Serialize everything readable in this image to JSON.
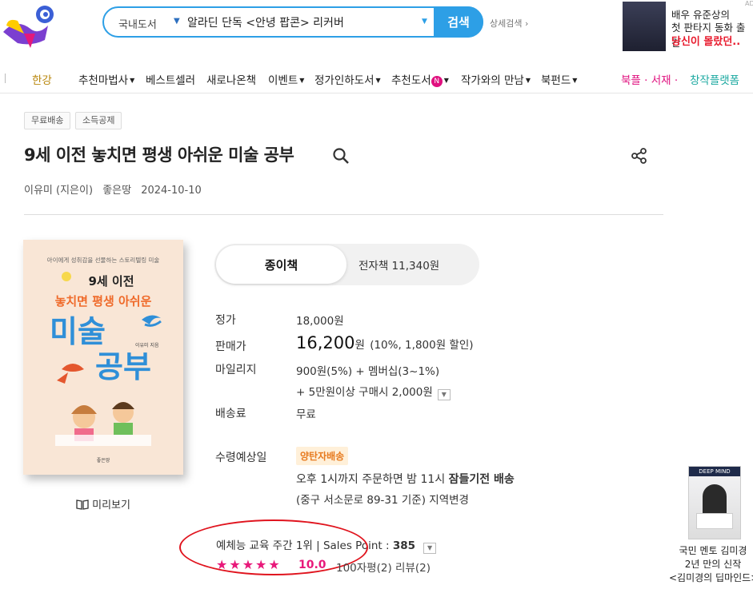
{
  "header": {
    "search": {
      "category": "국내도서",
      "query": "알라딘 단독 <안녕 팝콘> 리커버",
      "button": "검색"
    },
    "detail_search": "상세검색 ›",
    "ad": {
      "line1": "배우 유준상의",
      "line2": "첫 판타지 동화 출간",
      "line3": "당신이 몰랐던..",
      "mark": "AD"
    }
  },
  "nav": {
    "items": [
      {
        "label": "한강",
        "dropdown": false
      },
      {
        "label": "추천마법사",
        "dropdown": true
      },
      {
        "label": "베스트셀러",
        "dropdown": false
      },
      {
        "label": "새로나온책",
        "dropdown": false
      },
      {
        "label": "이벤트",
        "dropdown": true
      },
      {
        "label": "정가인하도서",
        "dropdown": true
      },
      {
        "label": "추천도서",
        "dropdown": true,
        "badge": "N"
      },
      {
        "label": "작가와의 만남",
        "dropdown": true
      },
      {
        "label": "북펀드",
        "dropdown": true
      }
    ],
    "right_links": {
      "bookple": "북플",
      "seojae": "서재",
      "changjak": "창작플랫폼"
    }
  },
  "product": {
    "tags": [
      "무료배송",
      "소득공제"
    ],
    "title": "9세 이전 놓치면 평생 아쉬운 미술 공부",
    "author": "이유미 (지은이)",
    "publisher": "좋은땅",
    "date": "2024-10-10",
    "cover": {
      "top_text": "아이에게 성취감을 선물하는 스토리텔링 미술",
      "title1": "9세 이전",
      "title2": "놓치면 평생 아쉬운",
      "title3": "미술",
      "title4": "공부",
      "author": "이유미 지음",
      "publisher": "좋은땅"
    },
    "preview": "미리보기",
    "format_tabs": {
      "paper": "종이책",
      "ebook": "전자책 11,340원"
    },
    "labels": {
      "list_price": "정가",
      "sale_price": "판매가",
      "mileage": "마일리지",
      "shipping": "배송료",
      "delivery_date": "수령예상일"
    },
    "list_price": "18,000원",
    "sale_price": "16,200",
    "sale_unit": "원",
    "discount": "(10%, 1,800원 할인)",
    "mileage1": "900원(5%) + 멤버십(3~1%)",
    "mileage2": "+ 5만원이상 구매시 2,000원",
    "shipping": "무료",
    "delivery_badge": "양탄자배송",
    "delivery_line1_a": "오후 1시까지 주문하면 밤 11시 ",
    "delivery_line1_b": "잠들기전 배송",
    "delivery_line2": "(중구 서소문로 89-31 기준) 지역변경",
    "rank": "예체능 교육 주간 1위  |  Sales Point : ",
    "sales_point": "385",
    "stars": "★★★★★",
    "rating": "10.0",
    "review_info": "100자평(2)   리뷰(2)"
  },
  "right_ad": {
    "book_title": "DEEP MIND",
    "line1": "국민 멘토 김미경",
    "line2": "2년 만의 신작",
    "line3": "<김미경의 딥마인드>"
  },
  "colors": {
    "accent": "#2d9fe6",
    "pink": "#e8197a",
    "red_circle": "#e0141e"
  }
}
